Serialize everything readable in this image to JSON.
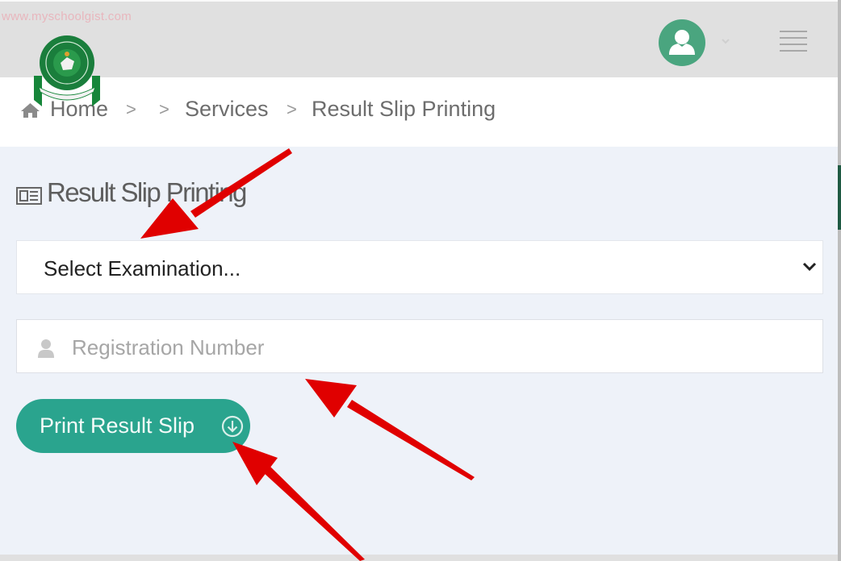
{
  "watermark": "www.myschoolgist.com",
  "header": {
    "logo": "jamb-logo",
    "avatar_icon": "user-avatar-icon",
    "dropdown_icon": "chevron-down-icon",
    "menu_icon": "hamburger-menu-icon"
  },
  "breadcrumb": {
    "home": "Home",
    "sep": ">",
    "services": "Services",
    "current": "Result Slip Printing"
  },
  "page": {
    "title": "Result Slip Printing",
    "title_icon": "newspaper-icon"
  },
  "form": {
    "exam_select": {
      "selected": "Select Examination..."
    },
    "reg_number": {
      "placeholder": "Registration Number",
      "value": ""
    },
    "print_button": {
      "label": "Print Result Slip",
      "icon": "download-circle-icon"
    }
  },
  "colors": {
    "accent": "#2aa48e",
    "avatar": "#4aa57f",
    "header_bg": "#e0e0e0",
    "content_bg": "#eef2f9",
    "annotation_arrow": "#e00000"
  }
}
